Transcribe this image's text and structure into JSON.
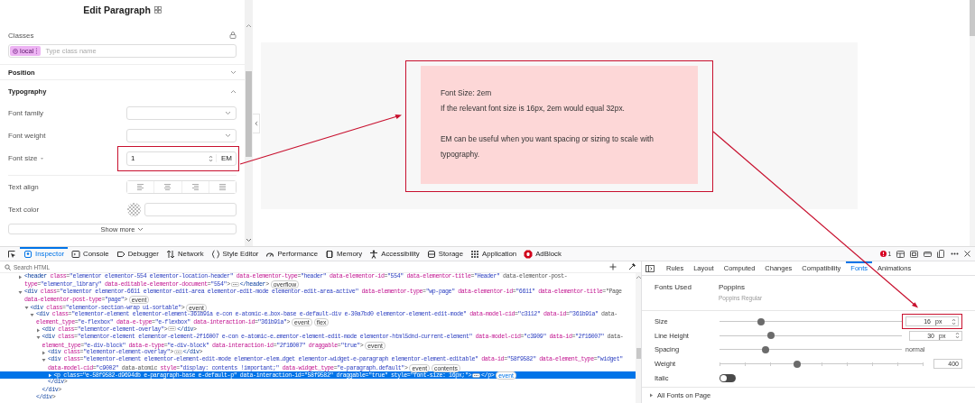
{
  "editor": {
    "title": "Edit Paragraph",
    "classes": {
      "label": "Classes",
      "chip": "local",
      "placeholder": "Type class name"
    },
    "sections": [
      {
        "title": "Position",
        "expanded": false
      },
      {
        "title": "Typography",
        "expanded": true,
        "controls": [
          {
            "kind": "select",
            "label": "Font family"
          },
          {
            "kind": "select",
            "label": "Font weight"
          },
          {
            "kind": "number",
            "label": "Font size",
            "value": "1",
            "unit": "EM",
            "highlighted": true
          },
          {
            "kind": "align",
            "label": "Text align"
          },
          {
            "kind": "color",
            "label": "Text color"
          }
        ]
      }
    ],
    "show_more": "Show more"
  },
  "preview": {
    "lines": [
      "Font Size: 2em",
      "If the relevant font size is 16px, 2em would equal 32px."
    ],
    "note": "EM can be useful when you want spacing or sizing to scale with typography.",
    "highlighted": true
  },
  "devtools": {
    "tools": [
      {
        "label": "Inspector",
        "selected": true
      },
      {
        "label": "Console",
        "selected": false
      },
      {
        "label": "Debugger",
        "selected": false
      },
      {
        "label": "Network",
        "selected": false
      },
      {
        "label": "Style Editor",
        "selected": false
      },
      {
        "label": "Performance",
        "selected": false
      },
      {
        "label": "Memory",
        "selected": false
      },
      {
        "label": "Accessibility",
        "selected": false
      },
      {
        "label": "Storage",
        "selected": false
      },
      {
        "label": "Application",
        "selected": false
      },
      {
        "label": "AdBlock",
        "selected": false
      }
    ],
    "error_count": "1",
    "search_placeholder": "Search HTML",
    "tree": [
      {
        "markup": [
          "<header class=\"elementor elementor-554 elementor-location-header\" data-elementor-type=\"header\" data-elementor-id=\"554\" data-elementor-title=\"Header\" data-elementor-post-",
          "type=\"elementor_library\" data-editable-elementor-document=\"554\">"
        ],
        "expanded": false,
        "end": "</header>",
        "badges": [
          "overflow"
        ],
        "selected": false
      },
      {
        "markup": [
          "<div class=\"elementor elementor-6611 elementor-edit-area elementor-edit-mode elementor-edit-area-active\" data-elementor-type=\"wp-page\" data-elementor-id=\"6611\" data-elementor-title=\"Page",
          "data-elementor-post-type=\"page\">"
        ],
        "expanded": true,
        "badges": [
          "event"
        ],
        "selected": false,
        "children": [
          {
            "markup": [
              "<div class=\"elementor-section-wrap ui-sortable\">"
            ],
            "expanded": true,
            "badges": [
              "event"
            ],
            "selected": false,
            "children": [
              {
                "markup": [
                  "<div class=\"elementor-element elementor-element-361b91a e-con e-atomic-e…box-base e-default-div e-30a7bd0 elementor-element-edit-mode\" data-model-cid=\"c3112\" data-id=\"361b91a\" data-",
                  "element_type=\"e-flexbox\" data-e-type=\"e-flexbox\" data-interaction-id=\"361b91a\">"
                ],
                "expanded": true,
                "badges": [
                  "event",
                  "flex"
                ],
                "selected": false,
                "close": "</div>",
                "children": [
                  {
                    "markup": [
                      "<div class=\"elementor-element-overlay\">"
                    ],
                    "expanded": false,
                    "end": "</div>",
                    "selected": false
                  },
                  {
                    "markup": [
                      "<div class=\"elementor-element elementor-element-2f16007 e-con e-atomic-e…ementor-element-edit-mode elementor-html5dnd-current-element\" data-model-cid=\"c3909\" data-id=\"2f16007\" data-",
                      "element_type=\"e-div-block\" data-e-type=\"e-div-block\" data-interaction-id=\"2f16007\" draggable=\"true\">"
                    ],
                    "expanded": true,
                    "badges": [
                      "event"
                    ],
                    "selected": false,
                    "close": "</div>",
                    "children": [
                      {
                        "markup": [
                          "<div class=\"elementor-element-overlay\">"
                        ],
                        "expanded": false,
                        "end": "</div>",
                        "selected": false
                      },
                      {
                        "markup": [
                          "<div class=\"elementor-element elementor-element-edit-mode elementor-elem…dget elementor-widget-e-paragraph elementor-element-editable\" data-id=\"58f9582\" data-element_type=\"widget\"",
                          "data-model-cid=\"c9002\" data-atomic style=\"display: contents !important;\" data-widget_type=\"e-paragraph.default\">"
                        ],
                        "expanded": true,
                        "badges": [
                          "event",
                          "contents"
                        ],
                        "selected": false,
                        "close": "</div>",
                        "children": [
                          {
                            "markup": [
                              "<p class=\"e-58f9582-d9694db e-paragraph-base e-default-p\" data-interaction-id=\"58f9582\" draggable=\"true\" style=\"font-size: 16px;\">"
                            ],
                            "expanded": false,
                            "end": "</p>",
                            "badges": [
                              "event"
                            ],
                            "selected": true
                          }
                        ]
                      }
                    ]
                  }
                ]
              }
            ]
          }
        ]
      }
    ],
    "sidebar": {
      "tabs": [
        {
          "label": "Rules",
          "selected": false
        },
        {
          "label": "Layout",
          "selected": false
        },
        {
          "label": "Computed",
          "selected": false
        },
        {
          "label": "Changes",
          "selected": false
        },
        {
          "label": "Compatibility",
          "selected": false
        },
        {
          "label": "Fonts",
          "selected": true
        },
        {
          "label": "Animations",
          "selected": false
        }
      ],
      "fonts_used_label": "Fonts Used",
      "font_name": "Poppins",
      "font_face": "Poppins Regular",
      "settings": [
        {
          "kind": "slider",
          "label": "Size",
          "level": 0.23,
          "value": "16",
          "unit": "px",
          "highlighted": true
        },
        {
          "kind": "slider",
          "label": "Line Height",
          "level": 0.28,
          "value": "30",
          "unit": "px"
        },
        {
          "kind": "slider",
          "label": "Spacing",
          "level": 0.25,
          "reading": "normal"
        },
        {
          "kind": "steps",
          "label": "Weight",
          "level": 0.38,
          "value": "400"
        },
        {
          "kind": "toggle",
          "label": "Italic",
          "on": false
        }
      ],
      "all_fonts": "All Fonts on Page"
    }
  }
}
